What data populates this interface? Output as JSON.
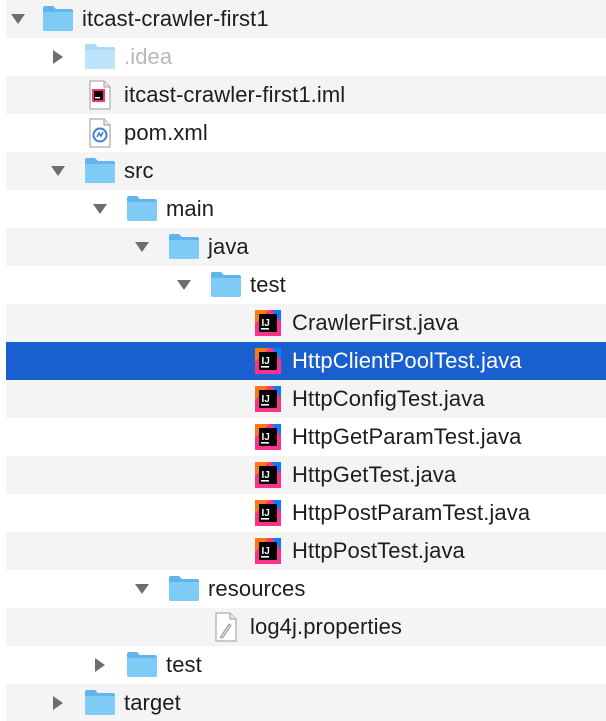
{
  "tree": {
    "items": [
      {
        "label": "itcast-crawler-first1",
        "icon": "folder-icon",
        "expanded": true
      },
      {
        "label": ".idea",
        "icon": "folder-icon",
        "expanded": false
      },
      {
        "label": "itcast-crawler-first1.iml",
        "icon": "intellij-module-file-icon"
      },
      {
        "label": "pom.xml",
        "icon": "maven-pom-file-icon"
      },
      {
        "label": "src",
        "icon": "folder-icon",
        "expanded": true
      },
      {
        "label": "main",
        "icon": "folder-icon",
        "expanded": true
      },
      {
        "label": "java",
        "icon": "folder-icon",
        "expanded": true
      },
      {
        "label": "test",
        "icon": "folder-icon",
        "expanded": true
      },
      {
        "label": "CrawlerFirst.java",
        "icon": "intellij-java-file-icon"
      },
      {
        "label": "HttpClientPoolTest.java",
        "icon": "intellij-java-file-icon",
        "selected": true
      },
      {
        "label": "HttpConfigTest.java",
        "icon": "intellij-java-file-icon"
      },
      {
        "label": "HttpGetParamTest.java",
        "icon": "intellij-java-file-icon"
      },
      {
        "label": "HttpGetTest.java",
        "icon": "intellij-java-file-icon"
      },
      {
        "label": "HttpPostParamTest.java",
        "icon": "intellij-java-file-icon"
      },
      {
        "label": "HttpPostTest.java",
        "icon": "intellij-java-file-icon"
      },
      {
        "label": "resources",
        "icon": "folder-icon",
        "expanded": true
      },
      {
        "label": "log4j.properties",
        "icon": "properties-file-icon"
      },
      {
        "label": "test",
        "icon": "folder-icon",
        "expanded": false
      },
      {
        "label": "target",
        "icon": "folder-icon",
        "expanded": false
      }
    ]
  },
  "colors": {
    "selection": "#1a5fd0",
    "folder": "#7ecbf6",
    "folder_tab": "#5fb5ec",
    "stripe": "#f4f4f4"
  }
}
